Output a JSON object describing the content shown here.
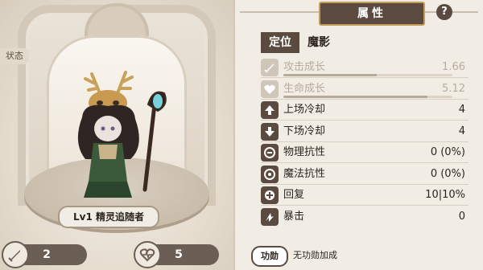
{
  "left_panel": {
    "status_tab": "状态",
    "hero_name": "Lv1  精灵追随者",
    "counters": [
      {
        "icon": "sword-icon",
        "value": "2"
      },
      {
        "icon": "heart-rate-icon",
        "value": "5"
      }
    ]
  },
  "right_panel": {
    "title": "属性",
    "help_label": "?",
    "role": {
      "label": "定位",
      "value": "魔影"
    },
    "stats": [
      {
        "icon": "attack-growth-icon",
        "label": "攻击成长",
        "value": "1.66",
        "dim": true,
        "growth": 0.55
      },
      {
        "icon": "health-growth-icon",
        "label": "生命成长",
        "value": "5.12",
        "dim": true,
        "growth": 0.85
      },
      {
        "icon": "enter-cooldown-icon",
        "label": "上场冷却",
        "value": "4",
        "dim": false
      },
      {
        "icon": "exit-cooldown-icon",
        "label": "下场冷却",
        "value": "4",
        "dim": false
      },
      {
        "icon": "physical-resist-icon",
        "label": "物理抗性",
        "value": "0 (0%)",
        "dim": false
      },
      {
        "icon": "magic-resist-icon",
        "label": "魔法抗性",
        "value": "0 (0%)",
        "dim": false
      },
      {
        "icon": "regen-icon",
        "label": "回复",
        "value": "10|10%",
        "dim": false
      },
      {
        "icon": "crit-icon",
        "label": "暴击",
        "value": "0",
        "dim": false
      }
    ],
    "feat": {
      "badge": "功勋",
      "text": "无功勋加成"
    }
  },
  "colors": {
    "panel_dark": "#5b4a40",
    "accent_gold": "#c29c5a",
    "background": "#efe9df"
  }
}
